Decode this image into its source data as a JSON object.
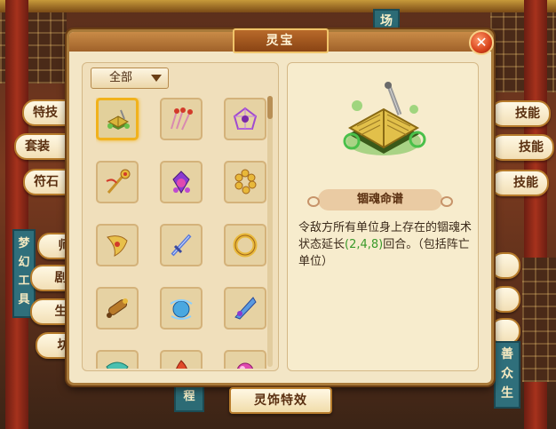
{
  "dialog": {
    "title": "灵宝",
    "close_icon": "close-icon",
    "filter_label": "全部",
    "selected_item": {
      "name": "锢魂命谱",
      "desc_before": "令敌方所有单位身上存在的锢魂术状态延长",
      "desc_highlight": "(2,4,8)",
      "desc_after": "回合。（包括阵亡单位）",
      "highlight_color": "#3a9a2a"
    },
    "items": [
      {
        "icon": "golden-book-icon",
        "selected": true
      },
      {
        "icon": "red-arrows-icon",
        "selected": false
      },
      {
        "icon": "purple-web-icon",
        "selected": false
      },
      {
        "icon": "golden-staff-icon",
        "selected": false
      },
      {
        "icon": "purple-gem-icon",
        "selected": false
      },
      {
        "icon": "golden-beads-icon",
        "selected": false
      },
      {
        "icon": "golden-horn-icon",
        "selected": false
      },
      {
        "icon": "blue-sword-icon",
        "selected": false
      },
      {
        "icon": "golden-ring-icon",
        "selected": false
      },
      {
        "icon": "bronze-scroll-icon",
        "selected": false
      },
      {
        "icon": "blue-orb-icon",
        "selected": false
      },
      {
        "icon": "blue-blade-icon",
        "selected": false
      },
      {
        "icon": "teal-fan-icon",
        "selected": false
      },
      {
        "icon": "red-fire-icon",
        "selected": false
      },
      {
        "icon": "pink-orb-icon",
        "selected": false
      }
    ]
  },
  "bottom_button": "灵饰特效",
  "background": {
    "left_buttons": [
      "特技",
      "套装",
      "符石"
    ],
    "left_lower_buttons": [
      "师",
      "剧",
      "生",
      "坊"
    ],
    "right_buttons": [
      "技能",
      "技能",
      "技能"
    ],
    "top_sign": "场",
    "left_vertical_tab": "梦幻工具",
    "right_vertical_tab": "善众生",
    "bottom_sign": "程"
  }
}
